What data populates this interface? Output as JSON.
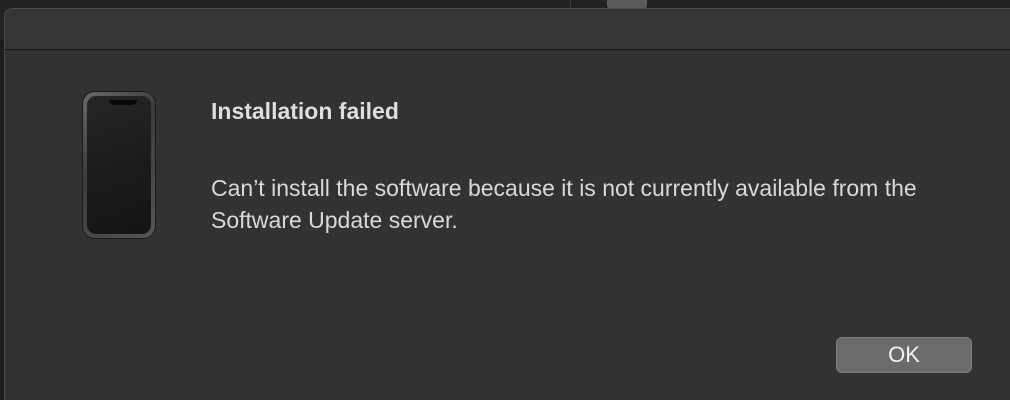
{
  "dialog": {
    "title": "Installation failed",
    "message": "Can’t install the software because it is not currently available from the Software Update server.",
    "ok_label": "OK"
  },
  "icons": {
    "device": "iphone-icon"
  },
  "colors": {
    "sheet_background": "#323232",
    "button_background": "#6b6b6b",
    "text": "#dedede"
  }
}
